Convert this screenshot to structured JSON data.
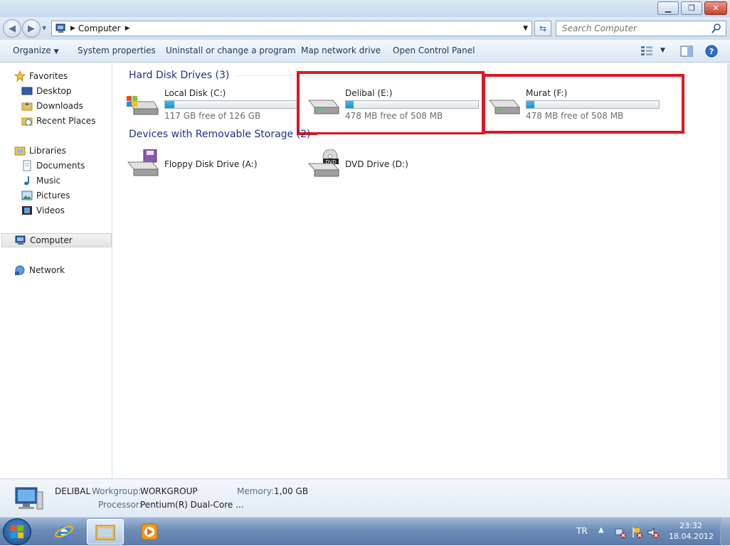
{
  "window": {
    "minimize_glyph": "▁",
    "maximize_glyph": "❐",
    "close_glyph": "✕"
  },
  "address": {
    "location": "Computer",
    "search_placeholder": "Search Computer"
  },
  "toolbar": {
    "organize": "Organize",
    "system_properties": "System properties",
    "uninstall": "Uninstall or change a program",
    "map_network_drive": "Map network drive",
    "open_control_panel": "Open Control Panel"
  },
  "nav": {
    "favorites": "Favorites",
    "desktop": "Desktop",
    "downloads": "Downloads",
    "recent_places": "Recent Places",
    "libraries": "Libraries",
    "documents": "Documents",
    "music": "Music",
    "pictures": "Pictures",
    "videos": "Videos",
    "computer": "Computer",
    "network": "Network"
  },
  "groups": {
    "hard_disks": "Hard Disk Drives (3)",
    "removable": "Devices with Removable Storage (2)"
  },
  "drives": {
    "c": {
      "name": "Local Disk (C:)",
      "free": "117 GB free of 126 GB",
      "used_fraction": 0.07
    },
    "e": {
      "name": "Delibal (E:)",
      "free": "478 MB free of 508 MB",
      "used_fraction": 0.06
    },
    "f": {
      "name": "Murat (F:)",
      "free": "478 MB free of 508 MB",
      "used_fraction": 0.06
    },
    "a": {
      "name": "Floppy Disk Drive (A:)"
    },
    "d": {
      "name": "DVD Drive (D:)"
    }
  },
  "details": {
    "computer_name": "DELIBAL",
    "workgroup_label": "Workgroup:",
    "workgroup_value": "WORKGROUP",
    "memory_label": "Memory:",
    "memory_value": "1,00 GB",
    "processor_label": "Processor:",
    "processor_value": "Pentium(R) Dual-Core ..."
  },
  "taskbar": {
    "language": "TR",
    "time": "23:32",
    "date": "18.04.2012"
  },
  "colors": {
    "highlight": "#e0161e",
    "group_header": "#1e3287",
    "bar_fill": "#1d8fd8"
  }
}
